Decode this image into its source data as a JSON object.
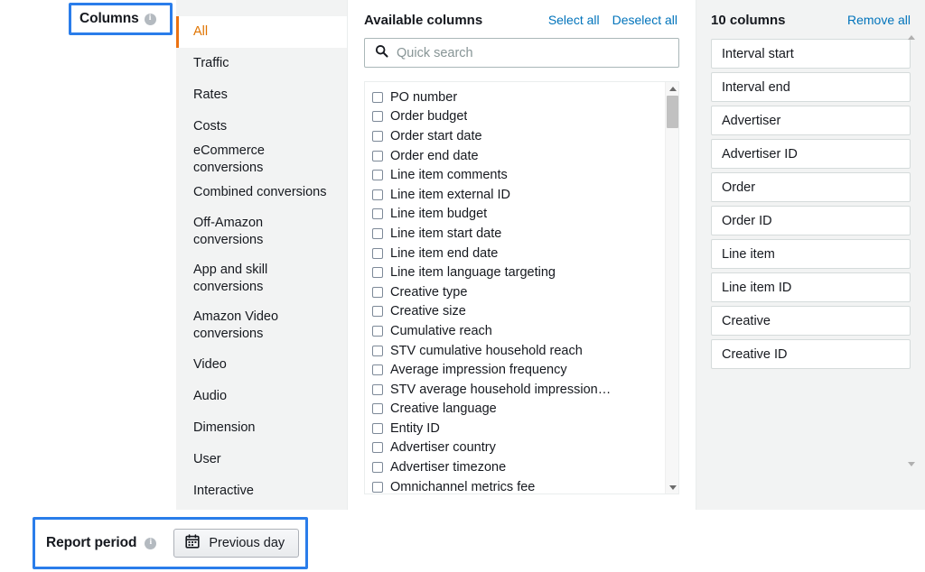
{
  "annotations": {
    "columns_label": "Columns",
    "report_period_label": "Report period",
    "highlight_color": "#2a7dea"
  },
  "category_nav": {
    "active": "All",
    "accent_color": "#ec7211",
    "items": [
      {
        "label": "All"
      },
      {
        "label": "Traffic"
      },
      {
        "label": "Rates"
      },
      {
        "label": "Costs"
      },
      {
        "label": "eCommerce conversions"
      },
      {
        "label": "Combined conversions"
      },
      {
        "label": "Off-Amazon conversions"
      },
      {
        "label": "App and skill conversions"
      },
      {
        "label": "Amazon Video conversions"
      },
      {
        "label": "Video"
      },
      {
        "label": "Audio"
      },
      {
        "label": "Dimension"
      },
      {
        "label": "User"
      },
      {
        "label": "Interactive"
      }
    ]
  },
  "available_columns": {
    "title": "Available columns",
    "select_all_label": "Select all",
    "deselect_all_label": "Deselect all",
    "search": {
      "placeholder": "Quick search",
      "value": "",
      "icon": "search-icon"
    },
    "items": [
      {
        "label": "PO number",
        "checked": false
      },
      {
        "label": "Order budget",
        "checked": false
      },
      {
        "label": "Order start date",
        "checked": false
      },
      {
        "label": "Order end date",
        "checked": false
      },
      {
        "label": "Line item comments",
        "checked": false
      },
      {
        "label": "Line item external ID",
        "checked": false
      },
      {
        "label": "Line item budget",
        "checked": false
      },
      {
        "label": "Line item start date",
        "checked": false
      },
      {
        "label": "Line item end date",
        "checked": false
      },
      {
        "label": "Line item language targeting",
        "checked": false
      },
      {
        "label": "Creative type",
        "checked": false
      },
      {
        "label": "Creative size",
        "checked": false
      },
      {
        "label": "Cumulative reach",
        "checked": false
      },
      {
        "label": "STV cumulative household reach",
        "checked": false
      },
      {
        "label": "Average impression frequency",
        "checked": false
      },
      {
        "label": "STV average household impression…",
        "checked": false
      },
      {
        "label": "Creative language",
        "checked": false
      },
      {
        "label": "Entity ID",
        "checked": false
      },
      {
        "label": "Advertiser country",
        "checked": false
      },
      {
        "label": "Advertiser timezone",
        "checked": false
      },
      {
        "label": "Omnichannel metrics fee",
        "checked": false
      }
    ]
  },
  "selected_columns": {
    "title": "10 columns",
    "remove_all_label": "Remove all",
    "items": [
      {
        "label": "Interval start"
      },
      {
        "label": "Interval end"
      },
      {
        "label": "Advertiser"
      },
      {
        "label": "Advertiser ID"
      },
      {
        "label": "Order"
      },
      {
        "label": "Order ID"
      },
      {
        "label": "Line item"
      },
      {
        "label": "Line item ID"
      },
      {
        "label": "Creative"
      },
      {
        "label": "Creative ID"
      }
    ]
  },
  "report_period": {
    "button_label": "Previous day",
    "button_icon": "calendar-icon"
  }
}
